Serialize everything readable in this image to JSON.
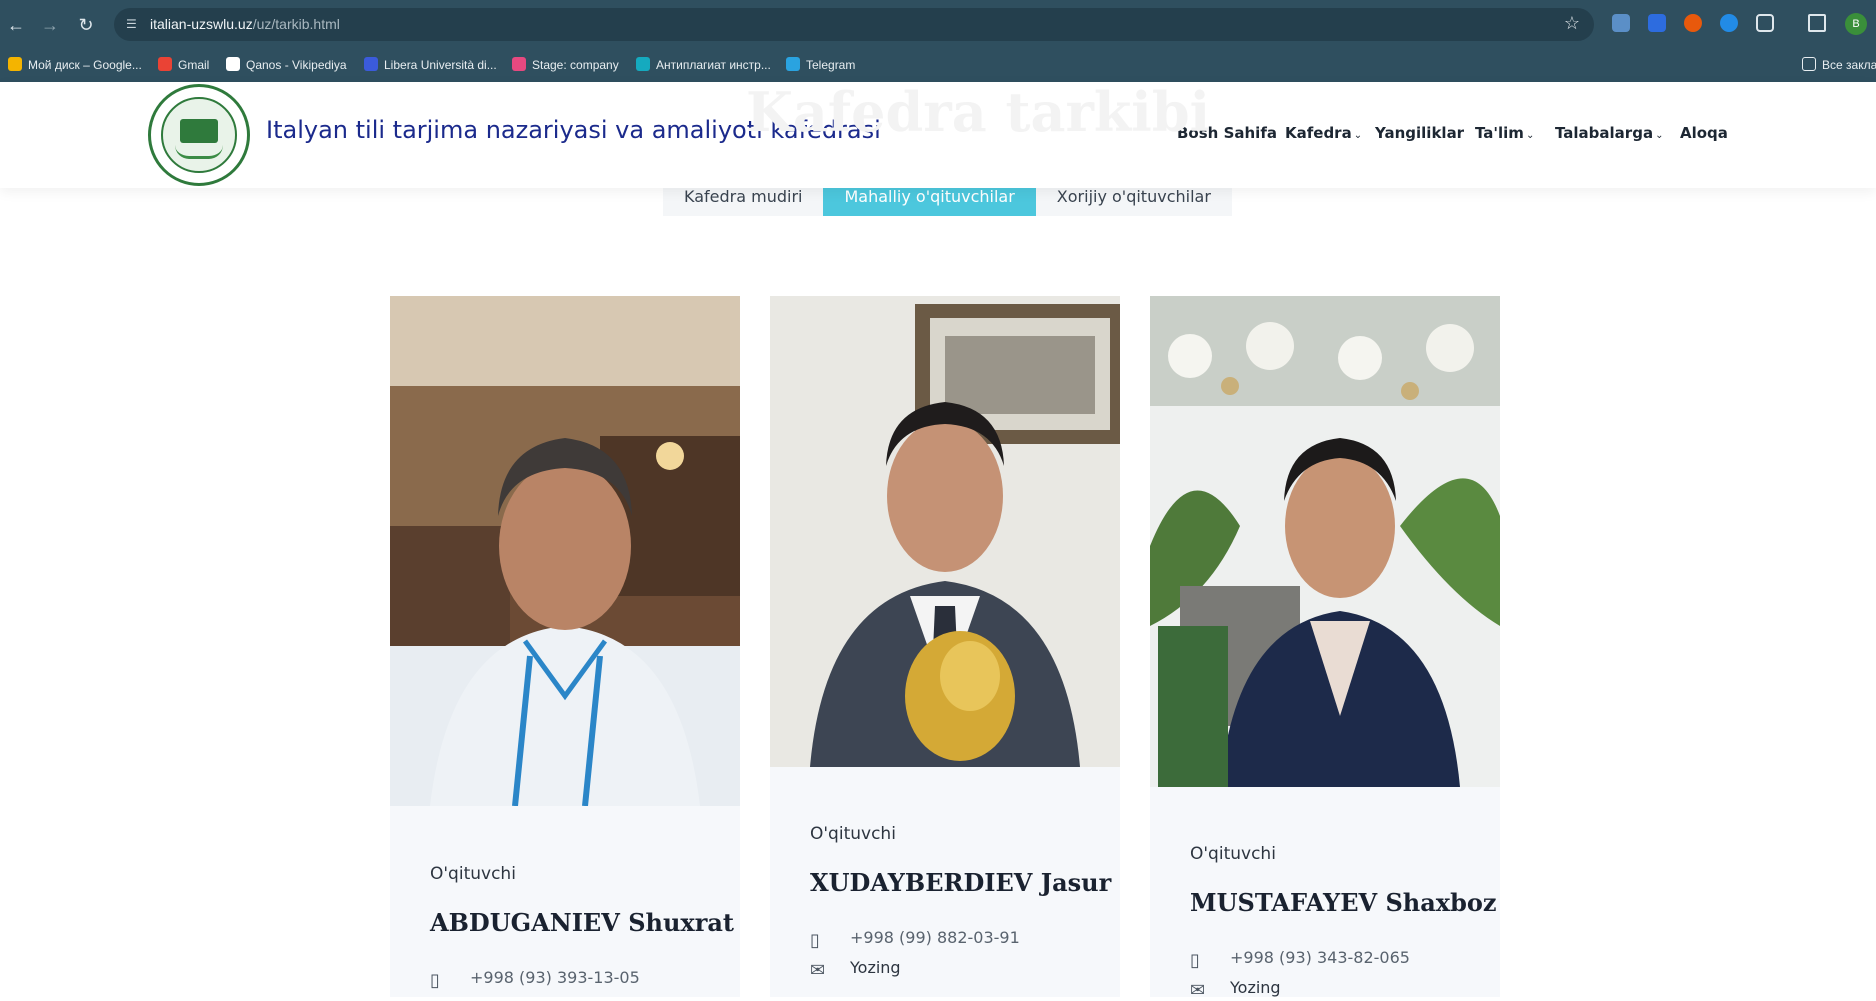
{
  "browser": {
    "url_host": "italian-uzswlu.uz",
    "url_path": "/uz/tarkib.html",
    "profile_initial": "B",
    "bookmarks": [
      {
        "label": "Мой диск – Google...",
        "color": "#f4b400"
      },
      {
        "label": "Gmail",
        "color": "#ea4335"
      },
      {
        "label": "Qanos - Vikipediya",
        "color": "#ffffff"
      },
      {
        "label": "Libera Università di...",
        "color": "#3b5bdb"
      },
      {
        "label": "Stage: company",
        "color": "#e64980"
      },
      {
        "label": "Антиплагиат инстр...",
        "color": "#15aabf"
      },
      {
        "label": "Telegram",
        "color": "#2aa3e0"
      }
    ],
    "bookmarks_folder": "Все закла"
  },
  "header": {
    "site_title": "Italyan tili tarjima nazariyasi va amaliyoti kafedrasi",
    "ghost_title": "Kafedra tarkibi",
    "nav": [
      {
        "label": "Bosh Sahifa",
        "has_dropdown": false
      },
      {
        "label": "Kafedra",
        "has_dropdown": true
      },
      {
        "label": "Yangiliklar",
        "has_dropdown": false
      },
      {
        "label": "Ta'lim",
        "has_dropdown": true
      },
      {
        "label": "Talabalarga",
        "has_dropdown": true
      },
      {
        "label": "Aloqa",
        "has_dropdown": false
      }
    ]
  },
  "tabs": {
    "items": [
      "Kafedra mudiri",
      "Mahalliy o'qituvchilar",
      "Xorijiy o'qituvchilar"
    ],
    "active_index": 1
  },
  "staff": [
    {
      "role": "O'qituvchi",
      "name": "ABDUGANIEV Shuxrat",
      "phone": "+998 (93) 393-13-05",
      "email": ""
    },
    {
      "role": "O'qituvchi",
      "name": "XUDAYBERDIEV Jasur",
      "phone": "+998 (99) 882-03-91",
      "email": "Yozing"
    },
    {
      "role": "O'qituvchi",
      "name": "MUSTAFAYEV Shaxboz",
      "phone": "+998 (93) 343-82-065",
      "email": "Yozing"
    }
  ],
  "colors": {
    "chrome": "#2f4f5f",
    "accent": "#4cc7dd",
    "title_blue": "#1b2a8c"
  }
}
